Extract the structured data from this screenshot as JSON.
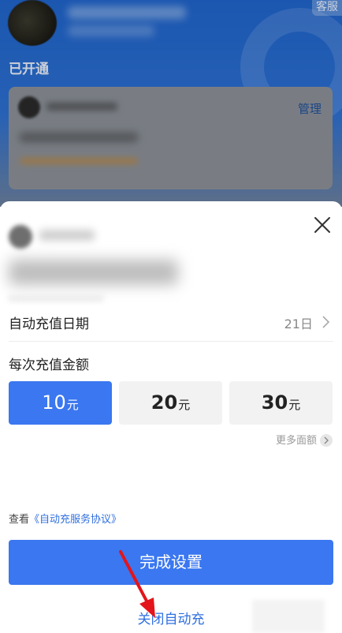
{
  "header": {
    "service_label": "客服",
    "opened_label": "已开通",
    "manage_label": "管理"
  },
  "sheet": {
    "date_label": "自动充值日期",
    "date_value": "21日",
    "amount_title": "每次充值金额",
    "amounts": [
      {
        "value": "10",
        "unit": "元",
        "selected": true
      },
      {
        "value": "20",
        "unit": "元",
        "selected": false
      },
      {
        "value": "30",
        "unit": "元",
        "selected": false
      }
    ],
    "more_label": "更多面额",
    "agreement_prefix": "查看",
    "agreement_link": "《自动充服务协议》",
    "complete_button": "完成设置",
    "close_auto_label": "关闭自动充"
  },
  "colors": {
    "accent": "#3a77f0",
    "link": "#2f6fe0",
    "annotation_arrow": "#e4141b"
  }
}
